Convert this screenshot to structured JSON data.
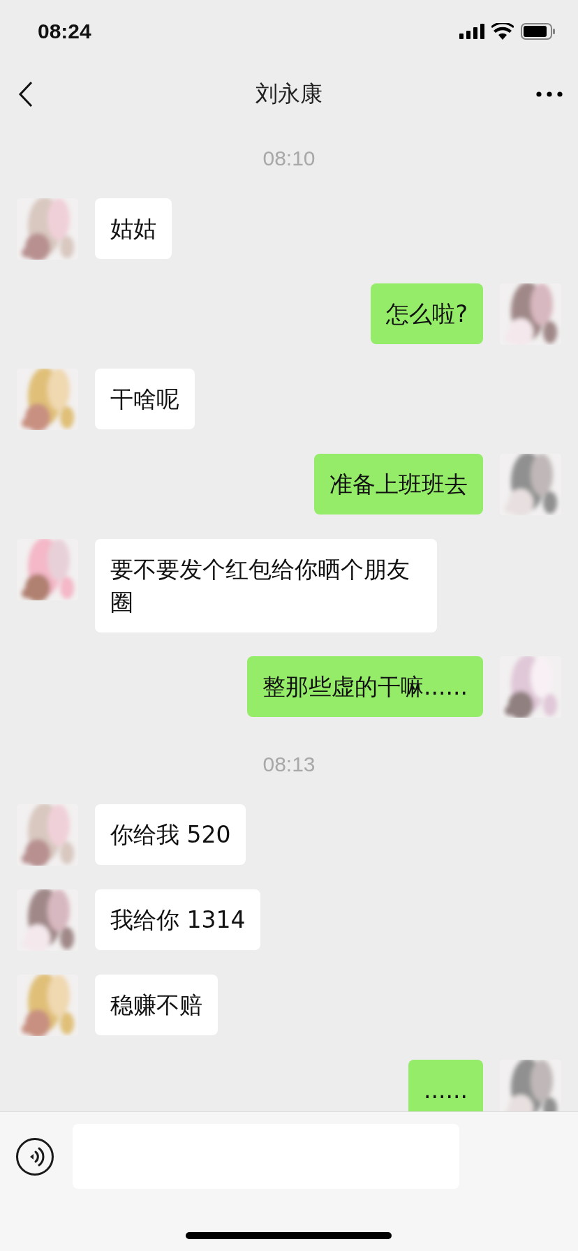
{
  "status_bar": {
    "time": "08:24"
  },
  "header": {
    "title": "刘永康"
  },
  "messages": [
    {
      "kind": "timestamp",
      "text": "08:10"
    },
    {
      "kind": "incoming",
      "text": "姑姑"
    },
    {
      "kind": "outgoing",
      "text": "怎么啦?"
    },
    {
      "kind": "incoming",
      "text": "干啥呢"
    },
    {
      "kind": "outgoing",
      "text": "准备上班班去"
    },
    {
      "kind": "incoming",
      "text": "要不要发个红包给你晒个朋友圈"
    },
    {
      "kind": "outgoing",
      "text": "整那些虚的干嘛......"
    },
    {
      "kind": "timestamp",
      "text": "08:13"
    },
    {
      "kind": "incoming",
      "text": "你给我 520"
    },
    {
      "kind": "incoming",
      "text": "我给你 1314"
    },
    {
      "kind": "incoming",
      "text": "稳赚不赔"
    },
    {
      "kind": "outgoing",
      "text": "......"
    }
  ]
}
